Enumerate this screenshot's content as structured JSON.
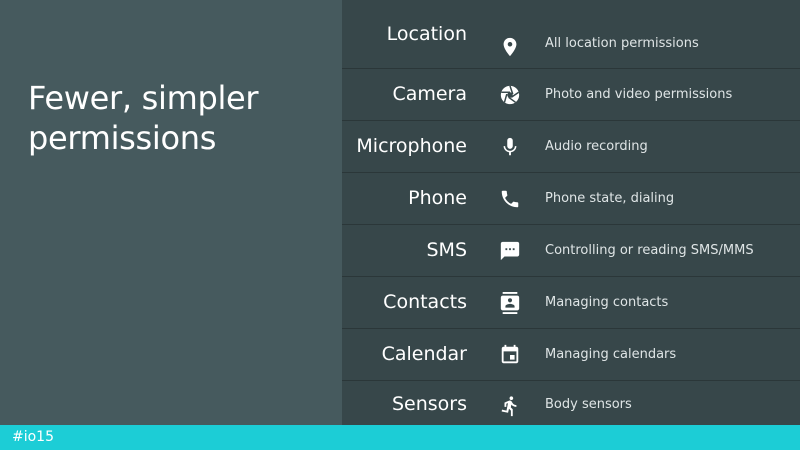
{
  "slide": {
    "title_line1": "Fewer, simpler",
    "title_line2": "permissions",
    "hashtag": "#io15"
  },
  "colors": {
    "left_panel": "#465a5e",
    "right_panel": "#37474a",
    "footer": "#1ccdd6",
    "text": "#ffffff"
  },
  "permissions": [
    {
      "name": "Location",
      "icon": "location-pin-icon",
      "description": "All location permissions"
    },
    {
      "name": "Camera",
      "icon": "camera-aperture-icon",
      "description": "Photo and video permissions"
    },
    {
      "name": "Microphone",
      "icon": "microphone-icon",
      "description": "Audio recording"
    },
    {
      "name": "Phone",
      "icon": "phone-icon",
      "description": "Phone state, dialing"
    },
    {
      "name": "SMS",
      "icon": "sms-chat-icon",
      "description": "Controlling or reading SMS/MMS"
    },
    {
      "name": "Contacts",
      "icon": "contacts-icon",
      "description": "Managing contacts"
    },
    {
      "name": "Calendar",
      "icon": "calendar-icon",
      "description": "Managing calendars"
    },
    {
      "name": "Sensors",
      "icon": "running-person-icon",
      "description": "Body sensors"
    }
  ]
}
